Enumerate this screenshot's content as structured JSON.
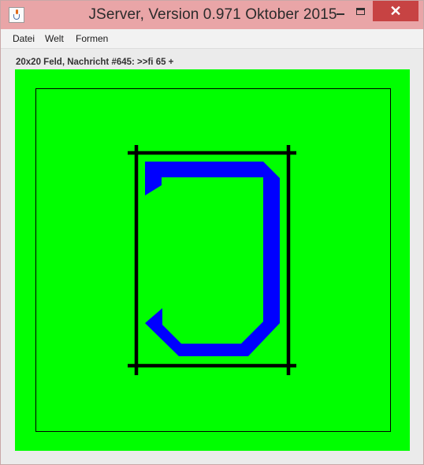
{
  "window": {
    "title": "JServer, Version 0.971 Oktober 2015",
    "app_icon": "java-cup-icon",
    "controls": {
      "minimize_icon": "minimize-icon",
      "maximize_icon": "maximize-icon",
      "close_label": "✕"
    },
    "titlebar_color": "#e9a5a7",
    "close_color": "#c74343"
  },
  "menu": {
    "items": [
      {
        "label": "Datei"
      },
      {
        "label": "Welt"
      },
      {
        "label": "Formen"
      }
    ]
  },
  "status": {
    "text": "20x20 Feld, Nachricht #645: >>fi 65 +"
  },
  "board": {
    "background_color": "#00ff00",
    "shape_color": "#0000ff",
    "line_color": "#000000",
    "grid_size": "20x20"
  }
}
